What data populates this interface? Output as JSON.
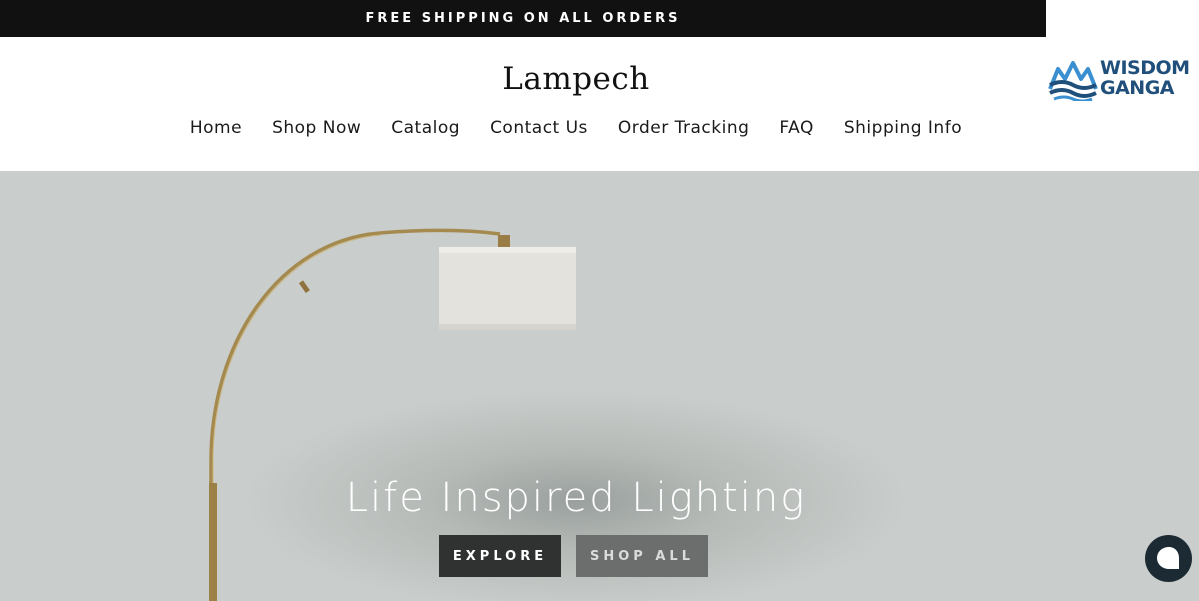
{
  "announcement": {
    "text": "FREE SHIPPING ON ALL ORDERS"
  },
  "header": {
    "brand": "Lampech",
    "nav": [
      "Home",
      "Shop Now",
      "Catalog",
      "Contact Us",
      "Order Tracking",
      "FAQ",
      "Shipping Info"
    ]
  },
  "watermark": {
    "line1": "WISDOM",
    "line2": "GANGA"
  },
  "hero": {
    "title": "Life Inspired Lighting",
    "explore_label": "EXPLORE",
    "shop_all_label": "SHOP ALL"
  },
  "icons": {
    "chat": "chat-bubble-icon"
  },
  "colors": {
    "announcement_bg": "#111111",
    "hero_bg": "#c9cdcb",
    "explore_bg": "#2f3231",
    "shop_all_bg": "#6c6e6d",
    "chat_bg": "#1c2a33"
  }
}
